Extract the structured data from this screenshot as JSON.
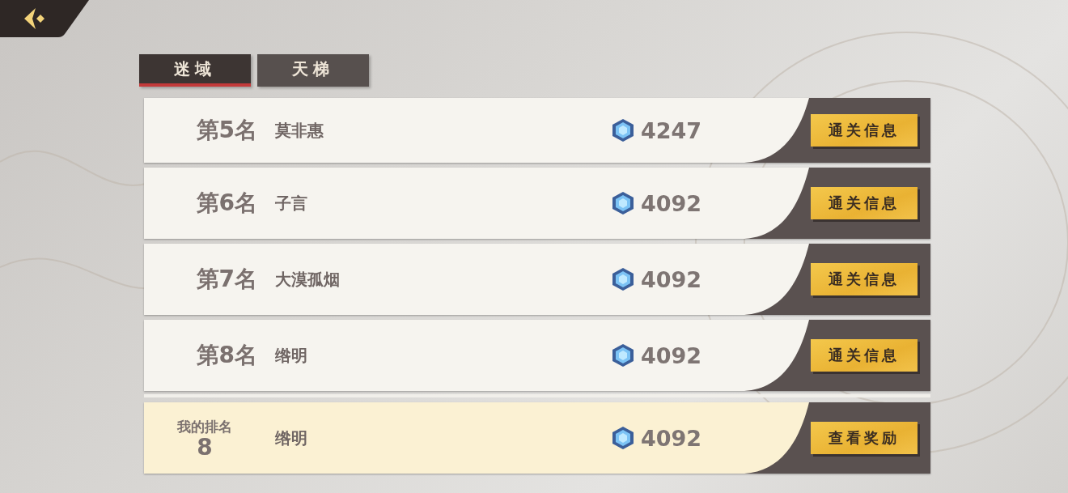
{
  "tabs": [
    {
      "label": "迷域",
      "selected": true
    },
    {
      "label": "天梯",
      "selected": false
    }
  ],
  "rows": [
    {
      "kind": "rank",
      "rank": "第5名",
      "name": "莫非惠",
      "score": "4247",
      "button": "通关信息"
    },
    {
      "kind": "rank",
      "rank": "第6名",
      "name": "子言",
      "score": "4092",
      "button": "通关信息"
    },
    {
      "kind": "rank",
      "rank": "第7名",
      "name": "大漠孤烟",
      "score": "4092",
      "button": "通关信息"
    },
    {
      "kind": "rank",
      "rank": "第8名",
      "name": "绺明",
      "score": "4092",
      "button": "通关信息"
    }
  ],
  "my_rank": {
    "label": "我的排名",
    "rank": "8",
    "name": "绺明",
    "score": "4092",
    "button": "查看奖励"
  }
}
